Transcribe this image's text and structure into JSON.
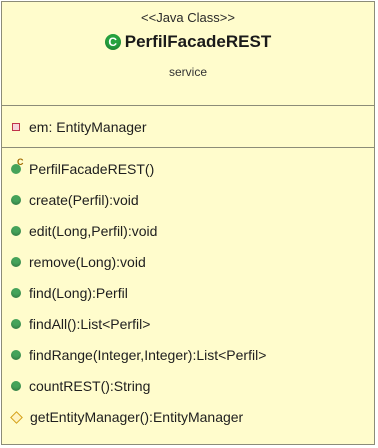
{
  "class": {
    "stereotype": "<<Java Class>>",
    "name": "PerfilFacadeREST",
    "package": "service",
    "icon": "class-c-icon"
  },
  "fields": [
    {
      "text": "em: EntityManager",
      "visibility": "private"
    }
  ],
  "methods": [
    {
      "text": "PerfilFacadeREST()",
      "visibility": "constructor"
    },
    {
      "text": "create(Perfil):void",
      "visibility": "public"
    },
    {
      "text": "edit(Long,Perfil):void",
      "visibility": "public"
    },
    {
      "text": "remove(Long):void",
      "visibility": "public"
    },
    {
      "text": "find(Long):Perfil",
      "visibility": "public"
    },
    {
      "text": "findAll():List<Perfil>",
      "visibility": "public"
    },
    {
      "text": "findRange(Integer,Integer):List<Perfil>",
      "visibility": "public"
    },
    {
      "text": "countREST():String",
      "visibility": "public"
    },
    {
      "text": "getEntityManager():EntityManager",
      "visibility": "protected"
    }
  ],
  "colors": {
    "box_fill": "#fffccc",
    "border": "#8c8c78",
    "public_icon": "#45a35a",
    "private_icon": "#c0334b",
    "protected_icon": "#d4a018"
  }
}
